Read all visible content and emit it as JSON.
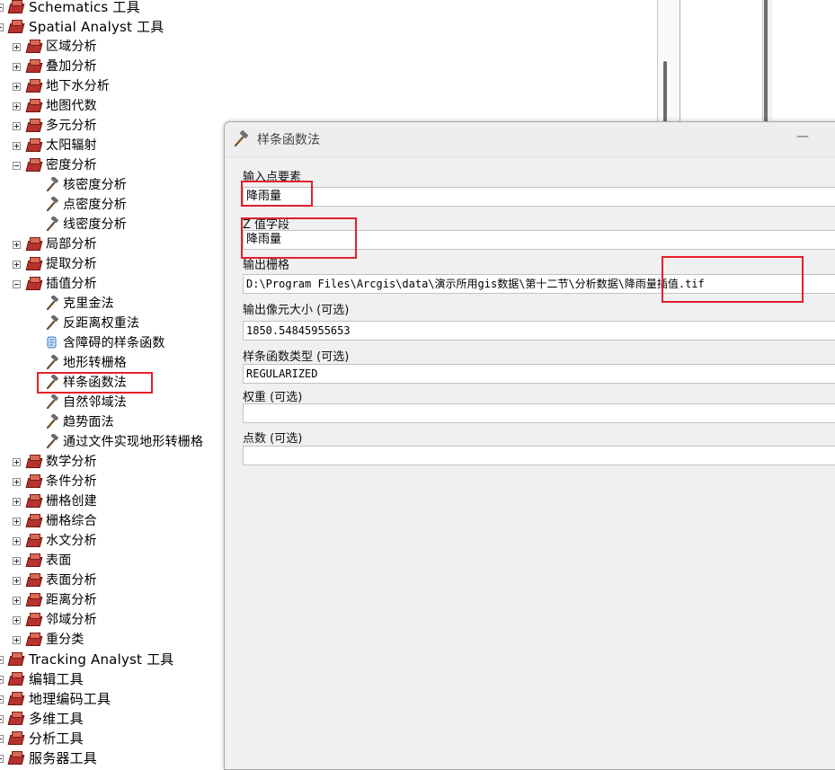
{
  "tree": {
    "top_items": [
      {
        "label": "Schematics 工具",
        "expanded": false
      },
      {
        "label": "Spatial Analyst 工具",
        "expanded": true
      }
    ],
    "spatial_children": [
      "区域分析",
      "叠加分析",
      "地下水分析",
      "地图代数",
      "多元分析",
      "太阳辐射",
      "密度分析"
    ],
    "density_tools": [
      "核密度分析",
      "点密度分析",
      "线密度分析"
    ],
    "mid_children": [
      "局部分析",
      "提取分析",
      "插值分析"
    ],
    "interp_tools": [
      "克里金法",
      "反距离权重法",
      "含障碍的样条函数",
      "地形转栅格",
      "样条函数法",
      "自然邻域法",
      "趋势面法",
      "通过文件实现地形转栅格"
    ],
    "rest_children": [
      "数学分析",
      "条件分析",
      "栅格创建",
      "栅格综合",
      "水文分析",
      "表面",
      "表面分析",
      "距离分析",
      "邻域分析",
      "重分类"
    ],
    "bottom_items": [
      "Tracking Analyst 工具",
      "编辑工具",
      "地理编码工具",
      "多维工具",
      "分析工具",
      "服务器工具"
    ]
  },
  "dialog": {
    "title": "样条函数法",
    "min_button": "—",
    "params": [
      {
        "label": "输入点要素",
        "value": "降雨量"
      },
      {
        "label": "Z 值字段",
        "value": "降雨量"
      },
      {
        "label": "输出栅格",
        "value": "D:\\Program Files\\Arcgis\\data\\演示所用gis数据\\第十二节\\分析数据\\降雨量插值.tif"
      },
      {
        "label": "输出像元大小 (可选)",
        "value": "1850.54845955653"
      },
      {
        "label": "样条函数类型 (可选)",
        "value": "REGULARIZED"
      },
      {
        "label": "权重 (可选)",
        "value": ""
      },
      {
        "label": "点数 (可选)",
        "value": ""
      }
    ]
  },
  "colors": {
    "highlight": "#e51f2a",
    "toolbox": "#b5322e"
  }
}
